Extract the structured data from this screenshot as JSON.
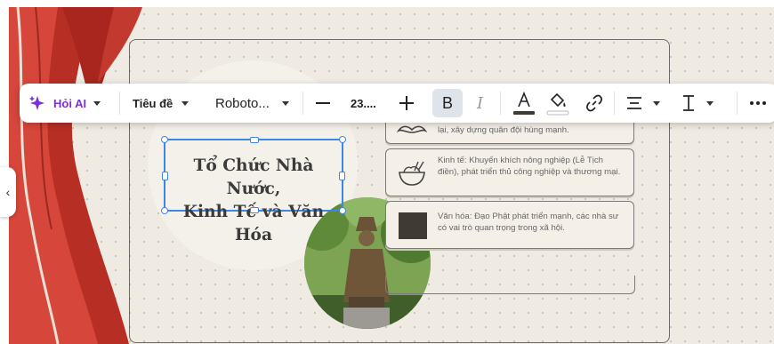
{
  "toolbar": {
    "ai_label": "Hỏi AI",
    "style_label": "Tiêu đề",
    "font_label": "Roboto...",
    "size_label": "23...."
  },
  "title_text": "Tổ Chức Nhà Nước,\nKinh Tế và Văn Hóa",
  "info_cards": [
    {
      "text": "Nhà nước tập quyền: Vua đứng đầu, đặt quan lại, xây dựng quân đội hùng mạnh.",
      "icon": "mustache-icon"
    },
    {
      "text": "Kinh tế: Khuyến khích nông nghiệp (Lễ Tịch điền), phát triển thủ công nghiệp và thương mại.",
      "icon": "rice-bowl-icon"
    },
    {
      "text": "Văn hóa: Đạo Phật phát triển mạnh, các nhà sư có vai trò quan trọng trong xã hội.",
      "icon": "dark-square-icon"
    }
  ],
  "colors": {
    "accent": "#3d85e6",
    "ai": "#7b2fd6",
    "scarf": "#c8372b"
  }
}
